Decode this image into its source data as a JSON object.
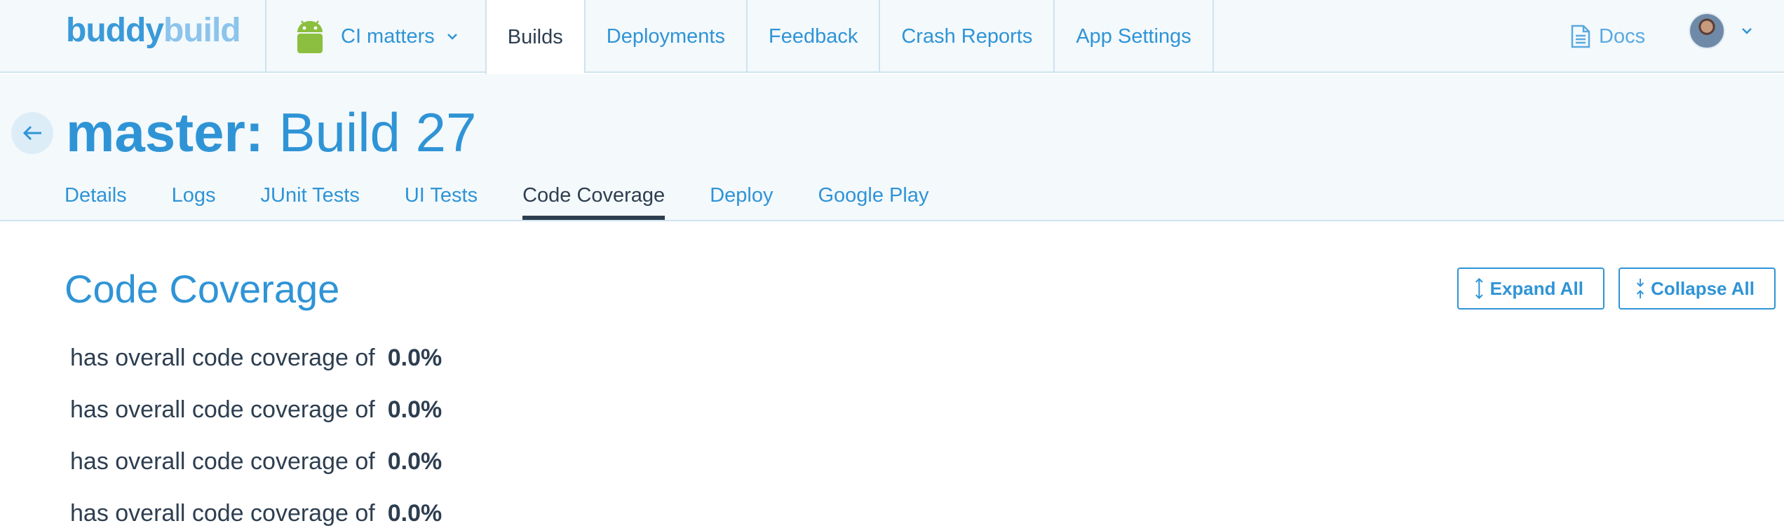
{
  "logo": {
    "part1": "buddy",
    "part2": "build"
  },
  "nav": {
    "app_name": "CI matters",
    "items": [
      "Builds",
      "Deployments",
      "Feedback",
      "Crash Reports",
      "App Settings"
    ],
    "docs_label": "Docs"
  },
  "header": {
    "branch": "master:",
    "build": "Build 27",
    "tabs": [
      "Details",
      "Logs",
      "JUnit Tests",
      "UI Tests",
      "Code Coverage",
      "Deploy",
      "Google Play"
    ],
    "active_tab": "Code Coverage"
  },
  "coverage": {
    "title": "Code Coverage",
    "expand_label": "Expand All",
    "collapse_label": "Collapse All",
    "rows": [
      {
        "label": "has overall code coverage of",
        "value": "0.0%"
      },
      {
        "label": "has overall code coverage of",
        "value": "0.0%"
      },
      {
        "label": "has overall code coverage of",
        "value": "0.0%"
      },
      {
        "label": "has overall code coverage of",
        "value": "0.0%"
      }
    ]
  },
  "colors": {
    "accent": "#2f94d6",
    "text_dark": "#2d3e50",
    "header_bg": "#f4f9fc",
    "android_green": "#8cbf3f"
  },
  "icons": [
    "android-icon",
    "chevron-down-icon",
    "document-icon",
    "avatar",
    "arrow-left-icon",
    "expand-icon",
    "collapse-icon"
  ]
}
